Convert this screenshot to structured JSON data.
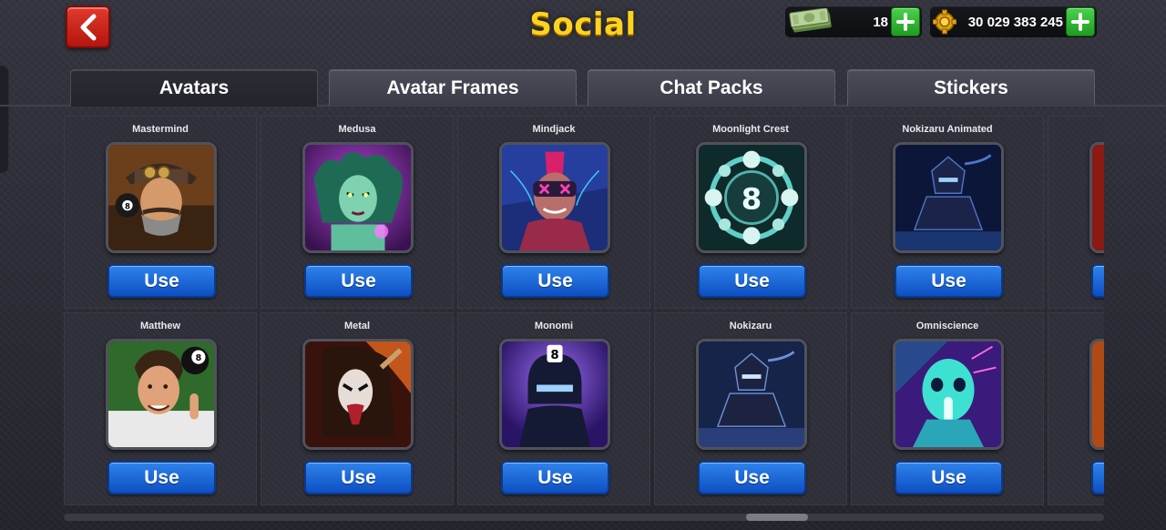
{
  "header": {
    "title": "Social",
    "back_icon": "chevron-left-icon"
  },
  "currency": {
    "cash": {
      "amount": "18",
      "icon": "cash-stack-icon"
    },
    "coins": {
      "amount": "30 029 383 245",
      "icon": "gear-coin-icon"
    }
  },
  "tabs": [
    {
      "label": "Avatars",
      "active": true
    },
    {
      "label": "Avatar Frames",
      "active": false
    },
    {
      "label": "Chat Packs",
      "active": false
    },
    {
      "label": "Stickers",
      "active": false
    }
  ],
  "use_label": "Use",
  "avatars": {
    "row1": [
      "Mastermind",
      "Medusa",
      "Mindjack",
      "Moonlight Crest",
      "Nokizaru Animated"
    ],
    "row2": [
      "Matthew",
      "Metal",
      "Monomi",
      "Nokizaru",
      "Omniscience"
    ]
  },
  "colors": {
    "title": "#ffd21e",
    "use_button": "#1f6ae0",
    "plus_button": "#2fb532",
    "back_button": "#cf2a20"
  }
}
